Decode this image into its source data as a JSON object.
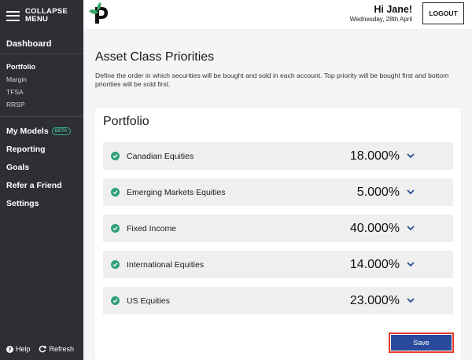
{
  "sidebar": {
    "collapse_line1": "COLLAPSE",
    "collapse_line2": "MENU",
    "dashboard": "Dashboard",
    "portfolio": "Portfolio",
    "accounts": [
      "Margin",
      "TFSA",
      "RRSP"
    ],
    "my_models": "My Models",
    "beta_badge": "BETA",
    "reporting": "Reporting",
    "goals": "Goals",
    "refer": "Refer a Friend",
    "settings": "Settings",
    "help": "Help",
    "refresh": "Refresh"
  },
  "header": {
    "greeting": "Hi Jane!",
    "date": "Wednesday, 28th April",
    "logout": "LOGOUT"
  },
  "main": {
    "title": "Asset Class Priorities",
    "description": "Define the order in which securities will be bought and sold in each account. Top priority will be bought first and bottom priorities will be sold first."
  },
  "card": {
    "title": "Portfolio",
    "rows": [
      {
        "label": "Canadian Equities",
        "percent": "18.000%"
      },
      {
        "label": "Emerging Markets Equities",
        "percent": "5.000%"
      },
      {
        "label": "Fixed Income",
        "percent": "40.000%"
      },
      {
        "label": "International Equities",
        "percent": "14.000%"
      },
      {
        "label": "US Equities",
        "percent": "23.000%"
      }
    ],
    "save": "Save"
  },
  "colors": {
    "sidebar_bg": "#2d2f34",
    "accent_green": "#2f9f7c",
    "save_blue": "#2a4b9b",
    "highlight_red": "#e53a2e"
  }
}
